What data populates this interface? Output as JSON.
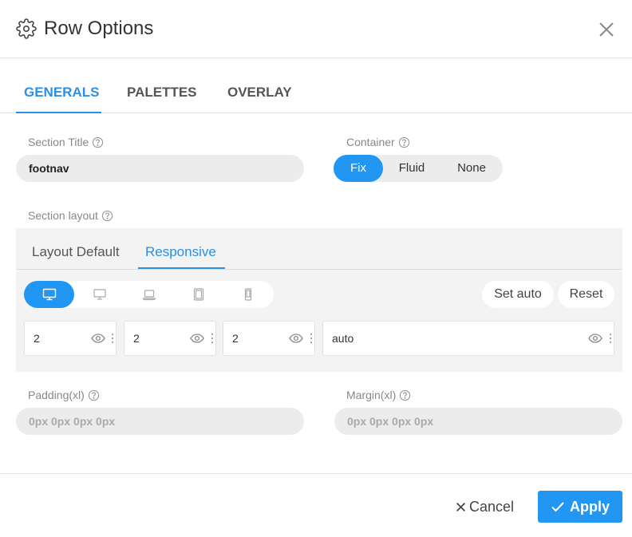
{
  "dialog": {
    "title": "Row Options",
    "icons": {
      "header": "gear-icon",
      "close": "close-icon"
    }
  },
  "tabs": [
    {
      "label": "GENERALS",
      "active": true
    },
    {
      "label": "PALETTES",
      "active": false
    },
    {
      "label": "OVERLAY",
      "active": false
    }
  ],
  "section_title": {
    "label": "Section Title",
    "value": "footnav"
  },
  "container": {
    "label": "Container",
    "options": [
      "Fix",
      "Fluid",
      "None"
    ],
    "selected": "Fix"
  },
  "section_layout": {
    "label": "Section layout",
    "sub_tabs": [
      {
        "label": "Layout Default",
        "active": false
      },
      {
        "label": "Responsive",
        "active": true
      }
    ],
    "devices": [
      "desktop-icon",
      "monitor-icon",
      "laptop-icon",
      "tablet-icon",
      "phone-icon"
    ],
    "active_device": "desktop-icon",
    "set_auto_label": "Set auto",
    "reset_label": "Reset",
    "columns": [
      "2",
      "2",
      "2",
      "auto"
    ]
  },
  "padding": {
    "label": "Padding(xl)",
    "placeholder": "0px 0px 0px 0px"
  },
  "margin": {
    "label": "Margin(xl)",
    "placeholder": "0px 0px 0px 0px"
  },
  "footer": {
    "cancel_label": "Cancel",
    "apply_label": "Apply"
  },
  "colors": {
    "accent": "#2196f3",
    "tab_accent": "#2a8fe6",
    "input_bg": "#ececec",
    "panel_bg": "#f3f3f3"
  }
}
